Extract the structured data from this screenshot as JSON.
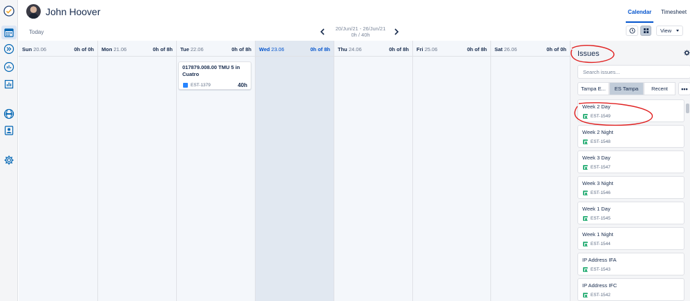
{
  "header": {
    "user_name": "John Hoover",
    "tabs": [
      {
        "label": "Calendar",
        "active": true
      },
      {
        "label": "Timesheet",
        "active": false
      }
    ]
  },
  "toolbar": {
    "today_label": "Today",
    "range_dates": "20/Jun/21 - 26/Jun/21",
    "range_hours": "0h / 40h",
    "view_label": "View"
  },
  "sidebar": {
    "icons": [
      "check-circle-icon",
      "calendar-icon",
      "forward-icon",
      "report-icon",
      "bar-chart-icon",
      "globe-icon",
      "user-card-icon",
      "gear-icon"
    ]
  },
  "calendar": {
    "days": [
      {
        "name": "Sun",
        "date": "20.06",
        "hours": "0h of 0h"
      },
      {
        "name": "Mon",
        "date": "21.06",
        "hours": "0h of 8h"
      },
      {
        "name": "Tue",
        "date": "22.06",
        "hours": "0h of 8h"
      },
      {
        "name": "Wed",
        "date": "23.06",
        "hours": "0h of 8h"
      },
      {
        "name": "Thu",
        "date": "24.06",
        "hours": "0h of 8h"
      },
      {
        "name": "Fri",
        "date": "25.06",
        "hours": "0h of 8h"
      },
      {
        "name": "Sat",
        "date": "26.06",
        "hours": "0h of 0h"
      }
    ],
    "worklog": {
      "title": "017879.008.00 TMU 5 in Cuatro",
      "key": "EST-1379",
      "hours": "40h"
    }
  },
  "issues_panel": {
    "title": "Issues",
    "search_placeholder": "Search issues...",
    "filters": [
      {
        "label": "Tampa E...",
        "active": false
      },
      {
        "label": "ES Tampa",
        "active": true
      },
      {
        "label": "Recent",
        "active": false
      },
      {
        "label": "•••",
        "active": false
      }
    ],
    "issues": [
      {
        "title": "Week 2 Day",
        "key": "EST-1549"
      },
      {
        "title": "Week 2 Night",
        "key": "EST-1548"
      },
      {
        "title": "Week 3 Day",
        "key": "EST-1547"
      },
      {
        "title": "Week 3 Night",
        "key": "EST-1546"
      },
      {
        "title": "Week 1 Day",
        "key": "EST-1545"
      },
      {
        "title": "Week 1 Night",
        "key": "EST-1544"
      },
      {
        "title": "IP Address IFA",
        "key": "EST-1543"
      },
      {
        "title": "IP Address IFC",
        "key": "EST-1542"
      }
    ]
  },
  "colors": {
    "accent": "#0052cc",
    "annotation": "#e01e1e",
    "issue_icon": "#36b37e"
  }
}
